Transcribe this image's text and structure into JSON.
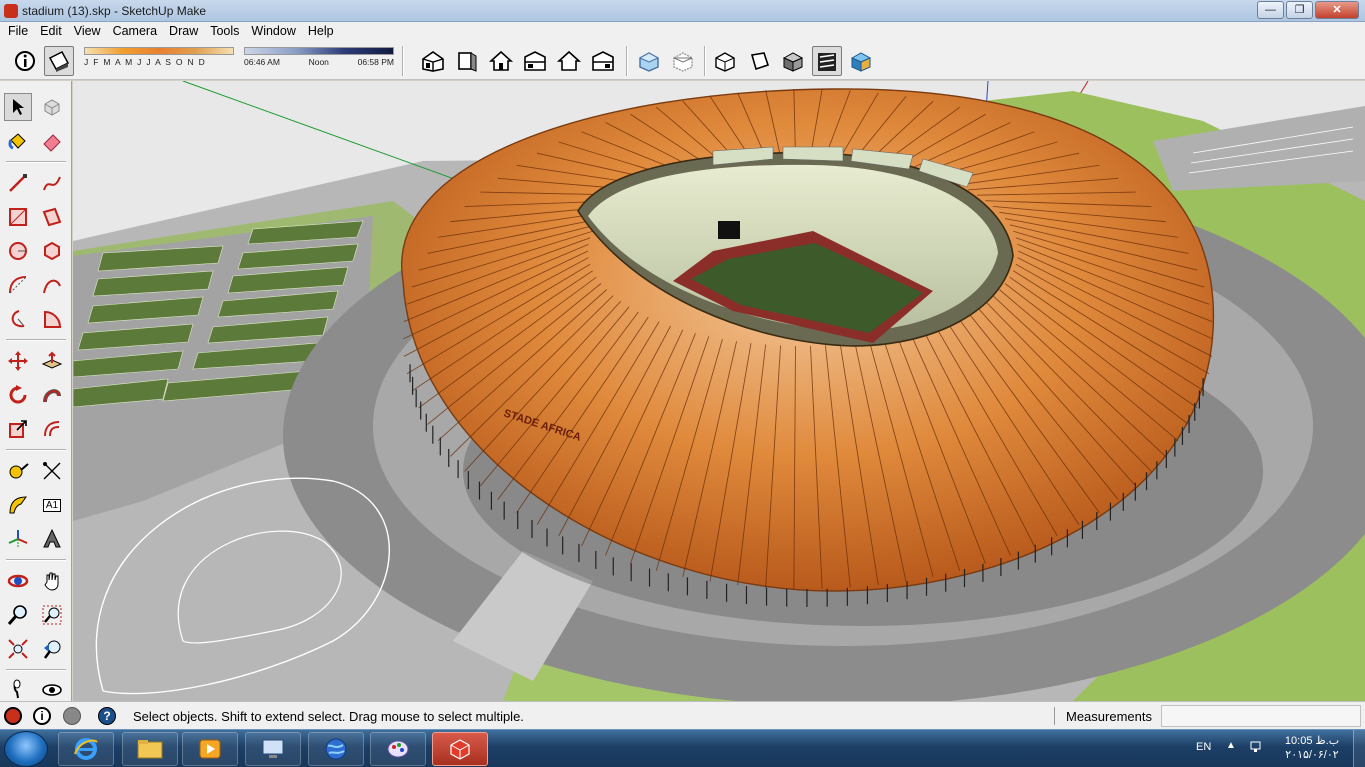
{
  "window": {
    "title": "stadium (13).skp - SketchUp Make",
    "min": "—",
    "max": "❐",
    "close": "✕"
  },
  "menu": [
    "File",
    "Edit",
    "View",
    "Camera",
    "Draw",
    "Tools",
    "Window",
    "Help"
  ],
  "shadows": {
    "months": "J F M A M J J A S O N D",
    "time_start": "06:46 AM",
    "time_mid": "Noon",
    "time_end": "06:58 PM"
  },
  "toolbar": {
    "views": [
      "iso-view-icon",
      "top-view-icon",
      "front-view-icon",
      "right-view-icon",
      "back-view-icon",
      "left-view-icon"
    ],
    "styles": [
      "xray-icon",
      "back-edges-icon",
      "wireframe-icon",
      "hidden-line-icon",
      "shaded-icon",
      "shaded-textures-icon",
      "monochrome-icon"
    ]
  },
  "left_toolbar": [
    [
      "select-icon",
      "make-component-icon"
    ],
    [
      "paint-bucket-icon",
      "eraser-icon"
    ],
    [
      "line-icon",
      "freehand-icon"
    ],
    [
      "rectangle-icon",
      "rotated-rectangle-icon"
    ],
    [
      "circle-icon",
      "polygon-icon"
    ],
    [
      "arc-icon",
      "two-point-arc-icon"
    ],
    [
      "three-point-arc-icon",
      "pie-icon"
    ],
    [
      "move-icon",
      "push-pull-icon"
    ],
    [
      "rotate-icon",
      "follow-me-icon"
    ],
    [
      "scale-icon",
      "offset-icon"
    ],
    [
      "tape-measure-icon",
      "dimension-icon"
    ],
    [
      "protractor-icon",
      "text-icon"
    ],
    [
      "axes-icon",
      "3d-text-icon"
    ],
    [
      "orbit-icon",
      "pan-icon"
    ],
    [
      "zoom-icon",
      "zoom-window-icon"
    ],
    [
      "zoom-extents-icon",
      "previous-view-icon"
    ],
    [
      "walk-icon",
      "look-around-icon"
    ]
  ],
  "text_tool_glyph": "A1",
  "status": {
    "message": "Select objects. Shift to extend select. Drag mouse to select multiple.",
    "measurements_label": "Measurements",
    "measurements_value": "",
    "help_glyph": "?",
    "info_glyph": "i"
  },
  "taskbar": {
    "lang": "EN",
    "tray_up": "▲",
    "time": "10:05 ب.ظ",
    "date": "۲۰۱۵/۰۶/۰۲"
  },
  "colors": {
    "roof": "#d9782c",
    "pitch": "#3d5a2a",
    "grass": "#9cc05e",
    "road": "#9c9c9c",
    "taskbar": "#1d3f66"
  }
}
